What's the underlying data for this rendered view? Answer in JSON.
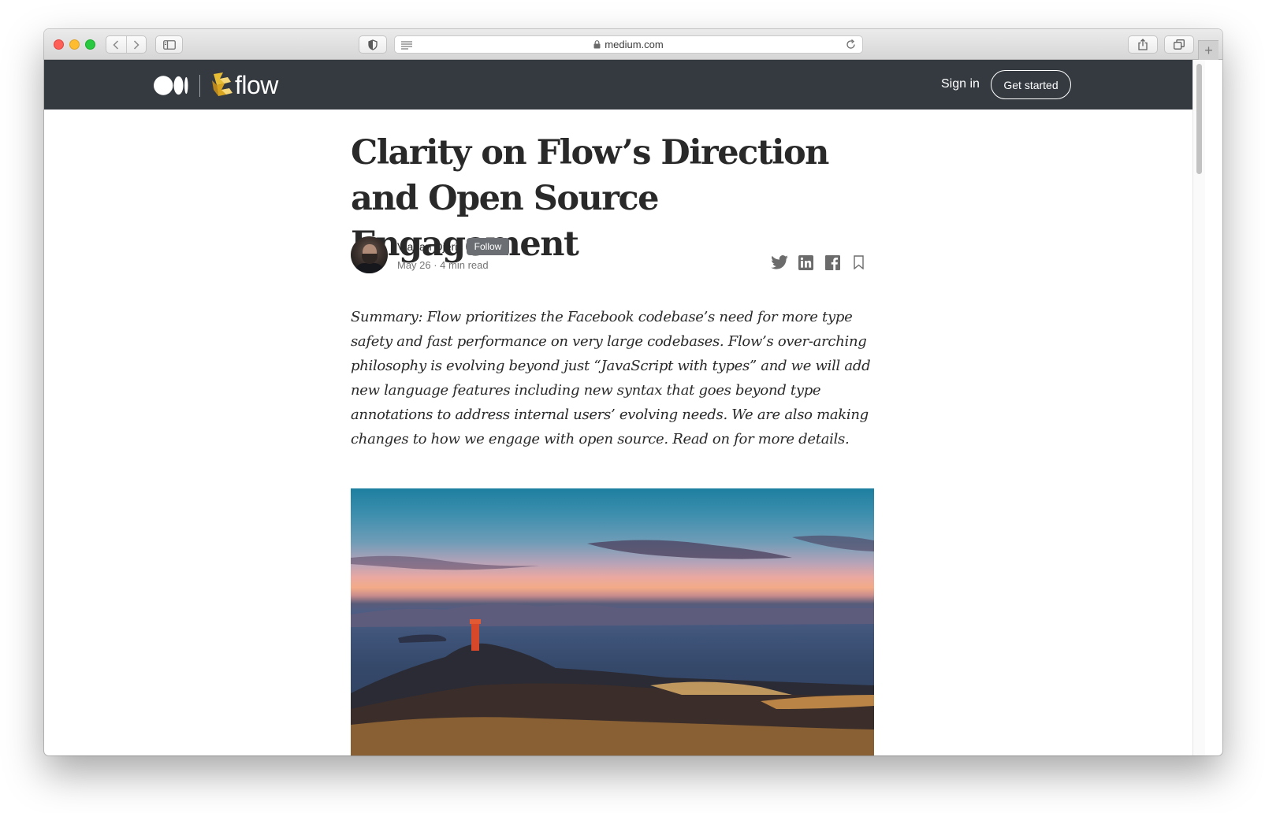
{
  "browser": {
    "url": "medium.com"
  },
  "site": {
    "publication_name": "flow",
    "signin_label": "Sign in",
    "get_started_label": "Get started"
  },
  "article": {
    "title": "Clarity on Flow’s Direction and Open Source Engagement",
    "author": "Vladan Djeric",
    "follow_label": "Follow",
    "meta": "May 26 · 4 min read",
    "summary": "Summary: Flow prioritizes the Facebook codebase’s need for more type safety and fast performance on very large codebases. Flow’s over-arching philosophy is evolving beyond just “JavaScript with types” and we will add new language features including new syntax that goes beyond type annotations to address internal users’ evolving needs. We are also making changes to how we engage with open source. Read on for more details.",
    "share_icons": [
      "twitter-icon",
      "linkedin-icon",
      "facebook-icon",
      "bookmark-icon"
    ]
  },
  "colors": {
    "header_bg": "#343a40",
    "text": "#292929",
    "meta_text": "#757575",
    "follow_bg": "#6b6f73",
    "flow_yellow": "#e8bd36"
  }
}
